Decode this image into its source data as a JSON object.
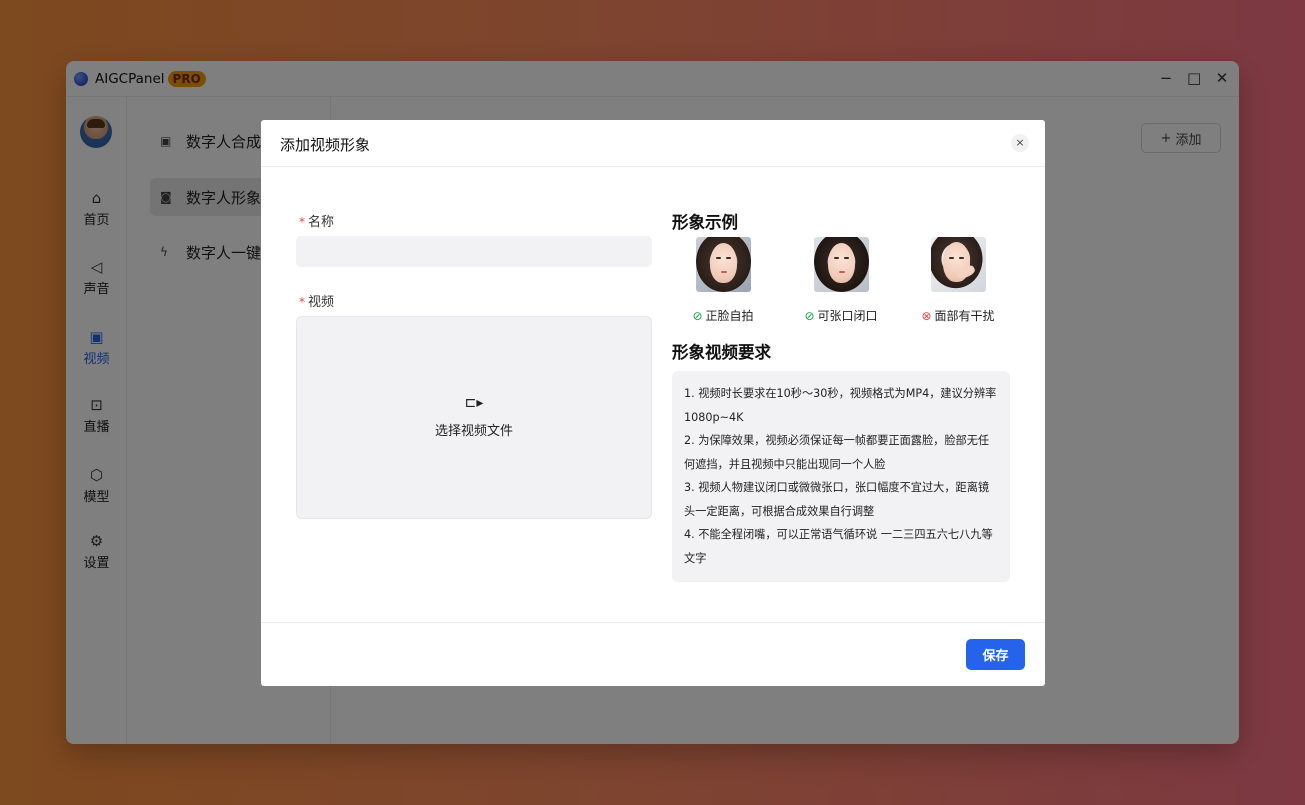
{
  "app": {
    "name": "AIGCPanel",
    "badge": "PRO"
  },
  "window_controls": {
    "minimize": "−",
    "maximize": "□",
    "close": "✕"
  },
  "sidebar": {
    "items": [
      {
        "label": "首页",
        "icon": "home-icon",
        "glyph": "⌂"
      },
      {
        "label": "声音",
        "icon": "speaker-icon",
        "glyph": "◁"
      },
      {
        "label": "视频",
        "icon": "video-icon",
        "glyph": "▣"
      },
      {
        "label": "直播",
        "icon": "live-tv-icon",
        "glyph": "⊡"
      },
      {
        "label": "模型",
        "icon": "cube-icon",
        "glyph": "⬡"
      },
      {
        "label": "设置",
        "icon": "gear-icon",
        "glyph": "⚙"
      }
    ],
    "active": "视频"
  },
  "subnav": {
    "items": [
      {
        "label": "数字人合成",
        "glyph": "▣"
      },
      {
        "label": "数字人形象",
        "glyph": "◙"
      },
      {
        "label": "数字人一键",
        "glyph": "ϟ"
      }
    ],
    "active": "数字人形象"
  },
  "toolbar": {
    "add_label": "添加",
    "add_glyph": "+"
  },
  "modal": {
    "title": "添加视频形象",
    "close_glyph": "×",
    "name_label": "名称",
    "name_value": "",
    "video_label": "视频",
    "upload_glyph": "⊏▸",
    "upload_text": "选择视频文件",
    "examples_title": "形象示例",
    "examples": [
      {
        "caption": "正脸自拍",
        "status": "ok",
        "status_glyph": "⊘"
      },
      {
        "caption": "可张口闭口",
        "status": "ok",
        "status_glyph": "⊘"
      },
      {
        "caption": "面部有干扰",
        "status": "bad",
        "status_glyph": "⊗"
      }
    ],
    "requirements_title": "形象视频要求",
    "requirements": [
      "1. 视频时长要求在10秒～30秒，视频格式为MP4，建议分辨率1080p~4K",
      "2. 为保障效果，视频必须保证每一帧都要正面露脸，脸部无任何遮挡，并且视频中只能出现同一个人脸",
      "3. 视频人物建议闭口或微微张口，张口幅度不宜过大，距离镜头一定距离，可根据合成效果自行调整",
      "4. 不能全程闭嘴，可以正常语气循环说 一二三四五六七八九等文字"
    ],
    "save_label": "保存",
    "colors": {
      "primary": "#2563eb",
      "ok": "#16a34a",
      "bad": "#ef4444"
    }
  }
}
